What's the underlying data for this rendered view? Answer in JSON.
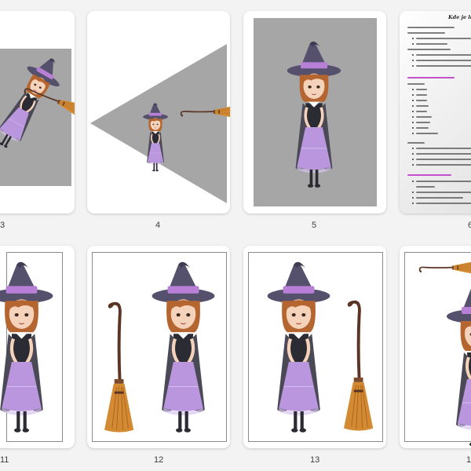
{
  "pages": [
    {
      "label": "3"
    },
    {
      "label": "4"
    },
    {
      "label": "5"
    },
    {
      "label": "6"
    },
    {
      "label": "11"
    },
    {
      "label": "12"
    },
    {
      "label": "13"
    },
    {
      "label": "1"
    }
  ],
  "document_page": {
    "title": "Kde je léta"
  },
  "colors": {
    "panel_gray": "#a6a6a6",
    "hat": "#55506c",
    "hat_band": "#b87fd6",
    "dress": "#b996dd",
    "cape": "#4a4a57",
    "hair": "#b5652f",
    "skin": "#f5d3bb",
    "broom_stick": "#5a3424",
    "broom_bristles": "#d48a32",
    "doc_heading": "#c03ec9"
  }
}
